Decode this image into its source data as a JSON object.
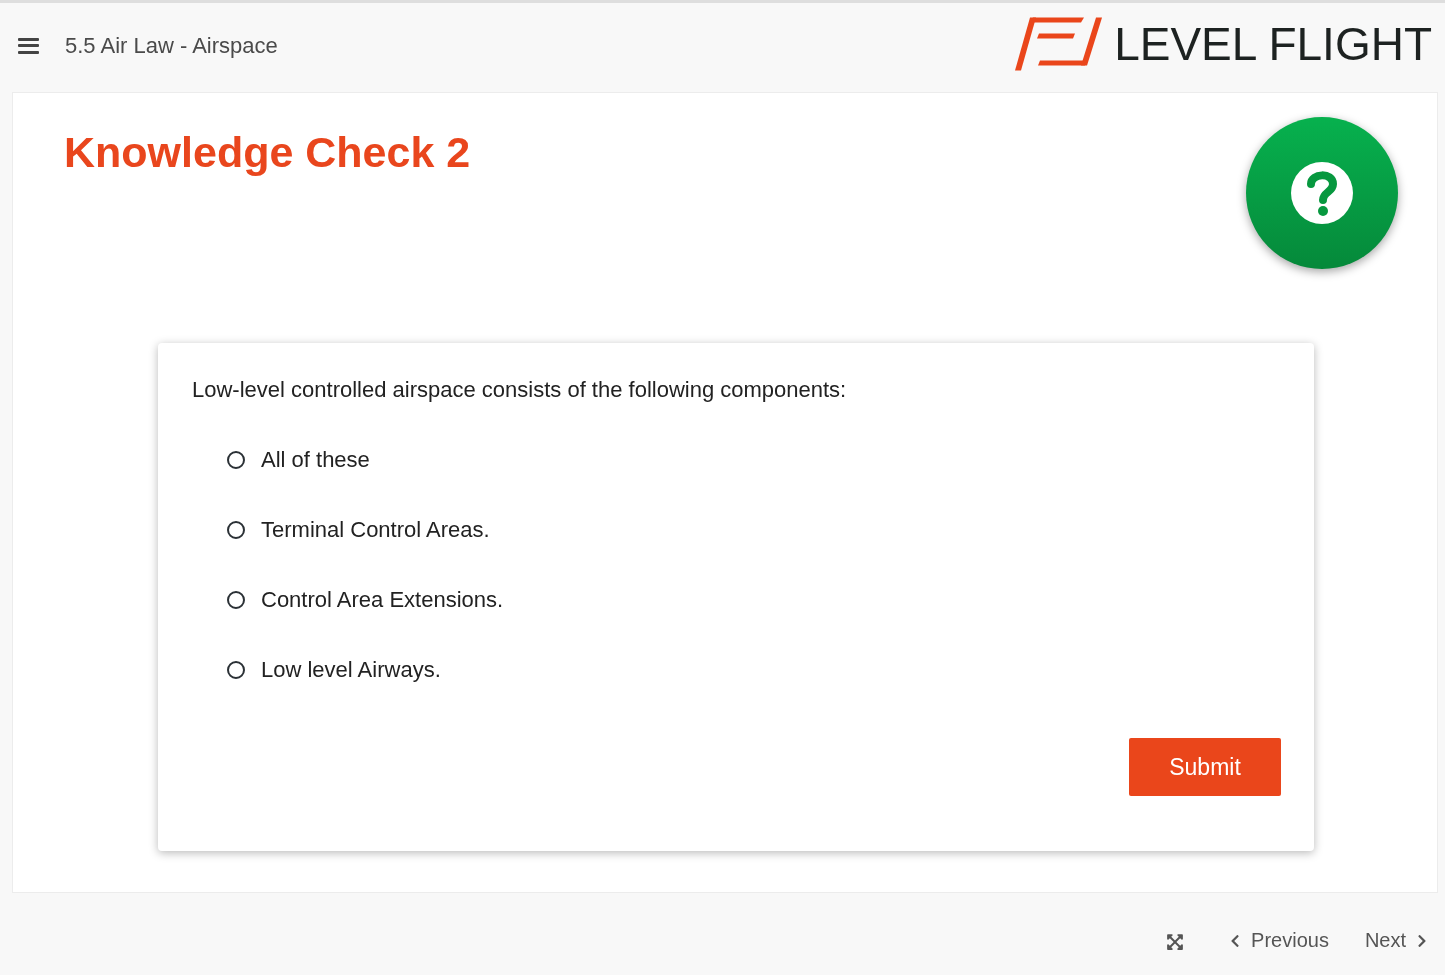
{
  "header": {
    "course_title": "5.5 Air Law - Airspace",
    "logo_text": "LEVEL FLIGHT"
  },
  "page": {
    "title": "Knowledge Check 2"
  },
  "question": {
    "prompt": "Low-level controlled airspace consists of the following components:",
    "options": [
      {
        "label": "All of these",
        "selected": false
      },
      {
        "label": "Terminal Control Areas.",
        "selected": false
      },
      {
        "label": "Control Area Extensions.",
        "selected": false
      },
      {
        "label": "Low level Airways.",
        "selected": false
      }
    ],
    "submit_button": "Submit"
  },
  "footer": {
    "previous": "Previous",
    "next": "Next"
  }
}
